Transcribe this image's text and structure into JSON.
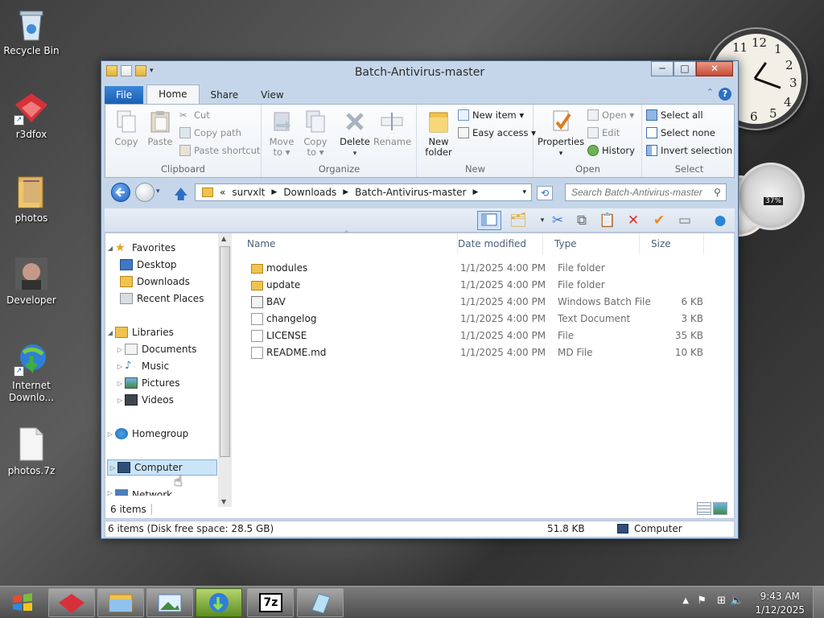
{
  "desktop": {
    "icons": [
      {
        "label": "Recycle Bin"
      },
      {
        "label": "r3dfox"
      },
      {
        "label": "photos"
      },
      {
        "label": "Developer"
      },
      {
        "label": "Internet Downlo..."
      },
      {
        "label": "photos.7z"
      }
    ]
  },
  "clock_gadget": {
    "numbers": [
      "12",
      "1",
      "2",
      "3",
      "4",
      "5",
      "6",
      "11"
    ]
  },
  "meter_gadget": {
    "cpu_percent": "37%"
  },
  "window": {
    "title": "Batch-Antivirus-master",
    "buttons": {
      "minimize": "─",
      "maximize": "□",
      "close": "✕"
    }
  },
  "ribbon_tabs": {
    "file": "File",
    "home": "Home",
    "share": "Share",
    "view": "View",
    "help": "?"
  },
  "ribbon": {
    "clipboard": {
      "label": "Clipboard",
      "copy": "Copy",
      "paste": "Paste",
      "cut": "Cut",
      "copy_path": "Copy path",
      "paste_shortcut": "Paste shortcut"
    },
    "organize": {
      "label": "Organize",
      "move_to": "Move to ▾",
      "copy_to": "Copy to ▾",
      "delete": "Delete",
      "rename": "Rename"
    },
    "new": {
      "label": "New",
      "new_folder": "New folder",
      "new_item": "New item ▾",
      "easy_access": "Easy access ▾"
    },
    "open": {
      "label": "Open",
      "properties": "Properties",
      "open": "Open ▾",
      "edit": "Edit",
      "history": "History"
    },
    "select": {
      "label": "Select",
      "select_all": "Select all",
      "select_none": "Select none",
      "invert_selection": "Invert selection"
    }
  },
  "address": {
    "parts": [
      "«",
      "survxlt",
      "Downloads",
      "Batch-Antivirus-master"
    ],
    "search_placeholder": "Search Batch-Antivirus-master"
  },
  "nav_pane": {
    "favorites": "Favorites",
    "desktop": "Desktop",
    "downloads": "Downloads",
    "recent_places": "Recent Places",
    "libraries": "Libraries",
    "documents": "Documents",
    "music": "Music",
    "pictures": "Pictures",
    "videos": "Videos",
    "homegroup": "Homegroup",
    "computer": "Computer",
    "network": "Network"
  },
  "columns": {
    "name": "Name",
    "date": "Date modified",
    "type": "Type",
    "size": "Size"
  },
  "files": [
    {
      "name": "modules",
      "date": "1/1/2025 4:00 PM",
      "type": "File folder",
      "size": "",
      "icon": "folder-icon"
    },
    {
      "name": "update",
      "date": "1/1/2025 4:00 PM",
      "type": "File folder",
      "size": "",
      "icon": "folder-icon"
    },
    {
      "name": "BAV",
      "date": "1/1/2025 4:00 PM",
      "type": "Windows Batch File",
      "size": "6 KB",
      "icon": "batch-file-icon"
    },
    {
      "name": "changelog",
      "date": "1/1/2025 4:00 PM",
      "type": "Text Document",
      "size": "3 KB",
      "icon": "text-file-icon"
    },
    {
      "name": "LICENSE",
      "date": "1/1/2025 4:00 PM",
      "type": "File",
      "size": "35 KB",
      "icon": "file-icon"
    },
    {
      "name": "README.md",
      "date": "1/1/2025 4:00 PM",
      "type": "MD File",
      "size": "10 KB",
      "icon": "file-icon"
    }
  ],
  "item_count": "6 items",
  "status": {
    "left": "6 items (Disk free space: 28.5 GB)",
    "size": "51.8 KB",
    "location": "Computer"
  },
  "taskbar": {
    "time": "9:43 AM",
    "date": "1/12/2025",
    "sevenzip_label": "7z"
  },
  "colors": {
    "accent": "#1a5fb4",
    "selection": "#cce4f7"
  }
}
